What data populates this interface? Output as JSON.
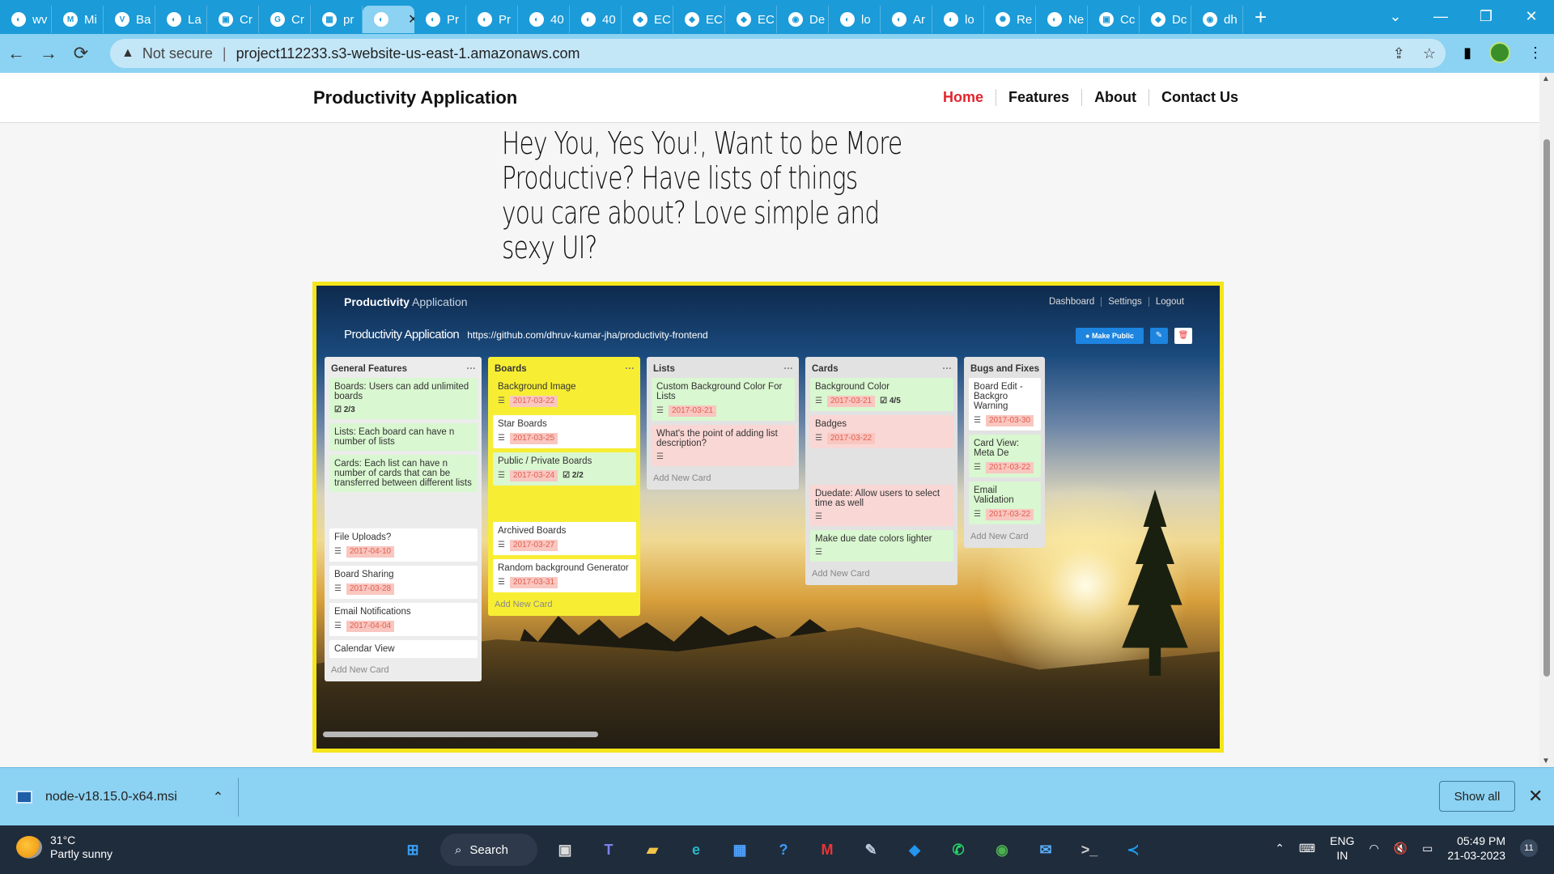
{
  "browser": {
    "tabs": [
      {
        "label": "wv",
        "icon": "globe-icon"
      },
      {
        "label": "Mi",
        "icon": "m-icon"
      },
      {
        "label": "Ba",
        "icon": "v-icon"
      },
      {
        "label": "La",
        "icon": "globe-icon"
      },
      {
        "label": "Cr",
        "icon": "box-icon"
      },
      {
        "label": "Cr",
        "icon": "google-icon"
      },
      {
        "label": "pr",
        "icon": "sheet-icon"
      },
      {
        "label": "",
        "icon": "globe-icon",
        "active": true
      },
      {
        "label": "Pr",
        "icon": "globe-icon"
      },
      {
        "label": "Pr",
        "icon": "globe-icon"
      },
      {
        "label": "40",
        "icon": "globe-icon"
      },
      {
        "label": "40",
        "icon": "globe-icon"
      },
      {
        "label": "EC",
        "icon": "aws-icon"
      },
      {
        "label": "EC",
        "icon": "aws-icon"
      },
      {
        "label": "EC",
        "icon": "aws-icon"
      },
      {
        "label": "De",
        "icon": "github-icon"
      },
      {
        "label": "lo",
        "icon": "globe-icon"
      },
      {
        "label": "Ar",
        "icon": "globe-icon"
      },
      {
        "label": "lo",
        "icon": "globe-icon"
      },
      {
        "label": "Re",
        "icon": "react-icon"
      },
      {
        "label": "Ne",
        "icon": "globe-icon"
      },
      {
        "label": "Cc",
        "icon": "box-icon"
      },
      {
        "label": "Dc",
        "icon": "gem-icon"
      },
      {
        "label": "dh",
        "icon": "github-icon"
      }
    ],
    "address": {
      "security": "Not secure",
      "url": "project112233.s3-website-us-east-1.amazonaws.com"
    }
  },
  "site": {
    "brand": "Productivity Application",
    "nav": [
      "Home",
      "Features",
      "About",
      "Contact Us"
    ],
    "hero": "Hey You, Yes You!, Want to be More Productive? Have lists of things you care about? Love simple and sexy UI?"
  },
  "inner_app": {
    "brand_bold": "Productivity",
    "brand_light": "Application",
    "nav": [
      "Dashboard",
      "Settings",
      "Logout"
    ],
    "board_title": "Productivity Application",
    "board_url": "https://github.com/dhruv-kumar-jha/productivity-frontend",
    "make_public": "Make Public",
    "add_new_card": "Add New Card",
    "lists": [
      {
        "title": "General Features",
        "color": "white",
        "cards": [
          {
            "text": "Boards: Users can add unlimited boards",
            "color": "green",
            "check": "2/3"
          },
          {
            "text": "Lists: Each board can have n number of lists",
            "color": "green"
          },
          {
            "text": "Cards: Each list can have n number of cards that can be transferred between different lists",
            "color": "green",
            "spacer": true
          },
          {
            "text": "File Uploads?",
            "color": "white",
            "desc": true,
            "due": "2017-04-10"
          },
          {
            "text": "Board Sharing",
            "color": "white",
            "desc": true,
            "due": "2017-03-28"
          },
          {
            "text": "Email Notifications",
            "color": "white",
            "desc": true,
            "due": "2017-04-04"
          },
          {
            "text": "Calendar View",
            "color": "white"
          }
        ]
      },
      {
        "title": "Boards",
        "color": "yellow",
        "cards": [
          {
            "text": "Background Image",
            "color": "yellow",
            "desc": true,
            "due": "2017-03-22"
          },
          {
            "text": "Star Boards",
            "color": "white",
            "desc": true,
            "due": "2017-03-25"
          },
          {
            "text": "Public / Private Boards",
            "color": "green",
            "desc": true,
            "due": "2017-03-24",
            "check": "2/2",
            "spacer": true
          },
          {
            "text": "Archived Boards",
            "color": "white",
            "desc": true,
            "due": "2017-03-27"
          },
          {
            "text": "Random background Generator",
            "color": "white",
            "desc": true,
            "due": "2017-03-31"
          }
        ]
      },
      {
        "title": "Lists",
        "color": "grey",
        "cards": [
          {
            "text": "Custom Background Color For Lists",
            "color": "green",
            "desc": true,
            "due": "2017-03-21"
          },
          {
            "text": "What's the point of adding list description?",
            "color": "red",
            "desc": true
          }
        ]
      },
      {
        "title": "Cards",
        "color": "grey",
        "cards": [
          {
            "text": "Background Color",
            "color": "green",
            "desc": true,
            "due": "2017-03-21",
            "check": "4/5"
          },
          {
            "text": "Badges",
            "color": "red",
            "desc": true,
            "due": "2017-03-22",
            "spacer": true
          },
          {
            "text": "Duedate: Allow users to select time as well",
            "color": "red",
            "desc": true
          },
          {
            "text": "Make due date colors lighter",
            "color": "green",
            "desc": true
          }
        ]
      },
      {
        "title": "Bugs and Fixes",
        "color": "grey",
        "cards": [
          {
            "text": "Board Edit - Backgro Warning",
            "color": "white",
            "desc": true,
            "due": "2017-03-30"
          },
          {
            "text": "Card View: Meta De",
            "color": "green",
            "desc": true,
            "due": "2017-03-22"
          },
          {
            "text": "Email Validation",
            "color": "green",
            "desc": true,
            "due": "2017-03-22"
          }
        ]
      }
    ]
  },
  "downloads": {
    "file": "node-v18.15.0-x64.msi",
    "show_all": "Show all"
  },
  "taskbar": {
    "temperature": "31°C",
    "condition": "Partly sunny",
    "search": "Search",
    "lang_top": "ENG",
    "lang_bottom": "IN",
    "time": "05:49 PM",
    "date": "21-03-2023",
    "notifications": "11",
    "apps": [
      "windows-icon",
      "task-view-icon",
      "teams-icon",
      "file-explorer-icon",
      "edge-icon",
      "store-icon",
      "help-icon",
      "mcafee-icon",
      "notepad-icon",
      "docker-icon",
      "whatsapp-icon",
      "chrome-icon",
      "mail-icon",
      "terminal-icon",
      "vscode-icon"
    ]
  },
  "colors": {
    "browser_tabbar": "#1b9bd8",
    "address_bar": "#8cd2f2",
    "nav_active": "#e0252c",
    "screenshot_border": "#f5e51a",
    "taskbar": "#1f2c3c"
  }
}
